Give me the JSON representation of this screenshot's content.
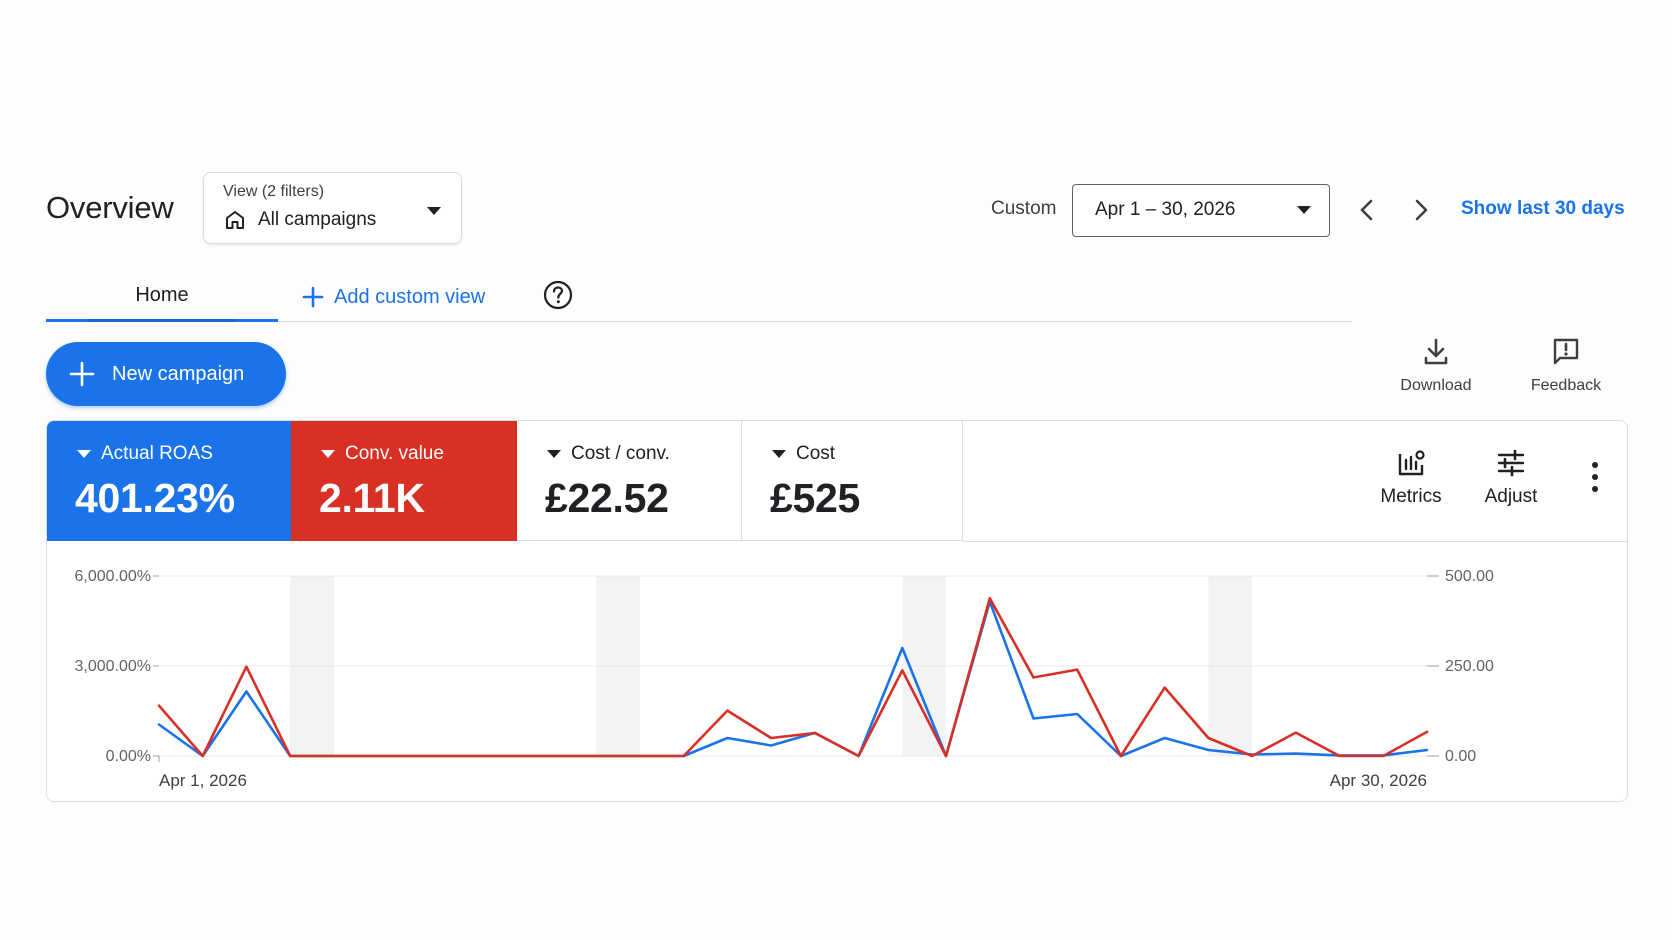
{
  "header": {
    "title": "Overview",
    "view_caption": "View (2 filters)",
    "view_value": "All campaigns",
    "range_label": "Custom",
    "date_range": "Apr 1 – 30, 2026",
    "show_last": "Show last 30 days"
  },
  "tabs": {
    "home": "Home",
    "add_custom_view": "Add custom view"
  },
  "actions": {
    "new_campaign": "New campaign",
    "download": "Download",
    "feedback": "Feedback"
  },
  "scorecards": [
    {
      "name": "Actual ROAS",
      "value": "401.23%",
      "color": "#1a73e8"
    },
    {
      "name": "Conv. value",
      "value": "2.11K",
      "color": "#d93025"
    },
    {
      "name": "Cost / conv.",
      "value": "£22.52"
    },
    {
      "name": "Cost",
      "value": "£525"
    }
  ],
  "card_tools": {
    "metrics": "Metrics",
    "adjust": "Adjust"
  },
  "colors": {
    "accent": "#1a73e8",
    "red": "#d93025",
    "grid": "#e8eaed",
    "weekend_band": "#f1f3f4"
  },
  "chart_data": {
    "type": "line",
    "x_start": "Apr 1, 2026",
    "x_end": "Apr 30, 2026",
    "x": [
      1,
      2,
      3,
      4,
      5,
      6,
      7,
      8,
      9,
      10,
      11,
      12,
      13,
      14,
      15,
      16,
      17,
      18,
      19,
      20,
      21,
      22,
      23,
      24,
      25,
      26,
      27,
      28,
      29,
      30
    ],
    "y_left": {
      "ticks": [
        "6,000.00%",
        "3,000.00%",
        "0.00%"
      ],
      "range": [
        0,
        6000
      ]
    },
    "y_right": {
      "ticks": [
        "500.00",
        "250.00",
        "0.00"
      ],
      "range": [
        0,
        500
      ]
    },
    "shaded_days": [
      4.5,
      11.5,
      18.5,
      25.5
    ],
    "series": [
      {
        "color": "#1a73e8",
        "axis": "left",
        "values": [
          1050,
          0,
          2150,
          0,
          0,
          0,
          0,
          0,
          0,
          0,
          0,
          0,
          0,
          600,
          350,
          770,
          0,
          3600,
          0,
          5150,
          1250,
          1400,
          0,
          600,
          200,
          50,
          80,
          20,
          20,
          200
        ]
      },
      {
        "color": "#d93025",
        "axis": "right",
        "values": [
          140,
          0,
          248,
          0,
          0,
          0,
          0,
          0,
          0,
          0,
          0,
          0,
          0,
          126,
          50,
          64,
          0,
          238,
          0,
          438,
          218,
          240,
          0,
          190,
          50,
          0,
          65,
          0,
          0,
          67
        ]
      }
    ],
    "grid": true
  }
}
